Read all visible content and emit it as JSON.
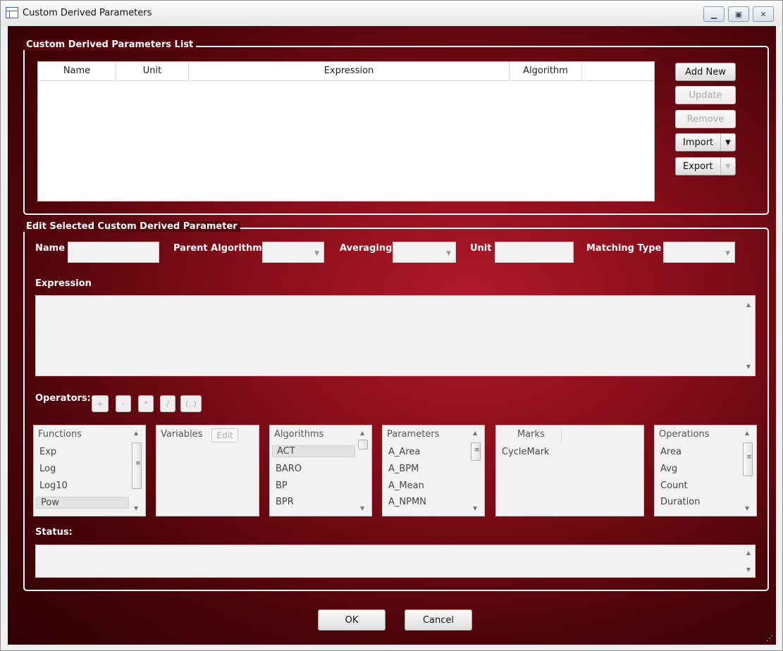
{
  "window": {
    "title": "Custom Derived Parameters"
  },
  "list_group": {
    "title": "Custom Derived Parameters List",
    "columns": [
      "Name",
      "Unit",
      "Expression",
      "Algorithm"
    ],
    "buttons": {
      "add_new": "Add New",
      "update": "Update",
      "remove": "Remove",
      "import": "Import",
      "export": "Export"
    }
  },
  "edit_group": {
    "title": "Edit Selected Custom Derived Parameter",
    "name_label": "Name",
    "name_value": "",
    "parent_algorithm_label": "Parent Algorithm",
    "parent_algorithm_value": "",
    "averaging_label": "Averaging",
    "averaging_value": "",
    "unit_label": "Unit",
    "unit_value": "",
    "matching_type_label": "Matching Type",
    "matching_type_value": "",
    "expression_label": "Expression",
    "expression_value": "",
    "operators_label": "Operators:",
    "operators": [
      "+",
      "-",
      "*",
      "/",
      "(..)"
    ],
    "functions": {
      "header": "Functions",
      "items": [
        "Exp",
        "Log",
        "Log10",
        "Pow"
      ],
      "selected": "Pow"
    },
    "variables": {
      "header": "Variables",
      "edit_label": "Edit"
    },
    "algorithms": {
      "header": "Algorithms",
      "items": [
        "ACT",
        "BARO",
        "BP",
        "BPR"
      ],
      "selected": "ACT"
    },
    "parameters": {
      "header": "Parameters",
      "items": [
        "A_Area",
        "A_BPM",
        "A_Mean",
        "A_NPMN"
      ]
    },
    "marks": {
      "header": "Marks",
      "items": [
        "CycleMark"
      ]
    },
    "operations": {
      "header": "Operations",
      "items": [
        "Area",
        "Avg",
        "Count",
        "Duration"
      ]
    },
    "status_label": "Status:",
    "status_value": ""
  },
  "footer": {
    "ok": "OK",
    "cancel": "Cancel"
  },
  "icons": {
    "app": "window-grid-icon",
    "minimize": "minimize-icon",
    "maximize": "maximize-icon",
    "close": "close-icon",
    "dropdown": "chevron-down-icon",
    "scroll_up": "scroll-up-arrow-icon",
    "scroll_down": "scroll-down-arrow-icon",
    "resize": "resize-grip-icon"
  },
  "colors": {
    "background": "#7a0b16",
    "group_border": "#ffffff",
    "label_text": "#ffffff"
  }
}
